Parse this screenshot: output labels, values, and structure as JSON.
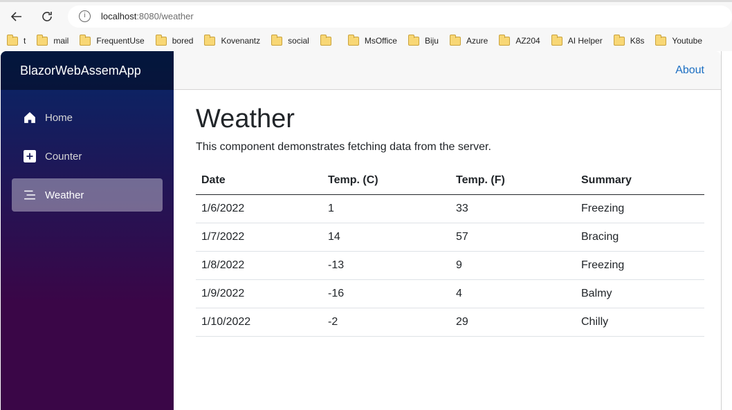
{
  "browser": {
    "url_host": "localhost",
    "url_path": ":8080/weather",
    "bookmarks": [
      "t",
      "mail",
      "FrequentUse",
      "bored",
      "Kovenantz",
      "social",
      "",
      "MsOffice",
      "Biju",
      "Azure",
      "AZ204",
      "AI Helper",
      "K8s",
      "Youtube"
    ]
  },
  "app": {
    "brand": "BlazorWebAssemApp",
    "about": "About"
  },
  "nav": {
    "items": [
      {
        "label": "Home",
        "icon": "home-icon"
      },
      {
        "label": "Counter",
        "icon": "plus-square-icon"
      },
      {
        "label": "Weather",
        "icon": "list-icon",
        "active": true
      }
    ]
  },
  "page": {
    "title": "Weather",
    "description": "This component demonstrates fetching data from the server."
  },
  "table": {
    "headers": [
      "Date",
      "Temp. (C)",
      "Temp. (F)",
      "Summary"
    ],
    "rows": [
      [
        "1/6/2022",
        "1",
        "33",
        "Freezing"
      ],
      [
        "1/7/2022",
        "14",
        "57",
        "Bracing"
      ],
      [
        "1/8/2022",
        "-13",
        "9",
        "Freezing"
      ],
      [
        "1/9/2022",
        "-16",
        "4",
        "Balmy"
      ],
      [
        "1/10/2022",
        "-2",
        "29",
        "Chilly"
      ]
    ]
  },
  "colors": {
    "accent": "#1b6ec2",
    "sidebar_top": "#052767",
    "sidebar_bottom": "#3a0647"
  }
}
